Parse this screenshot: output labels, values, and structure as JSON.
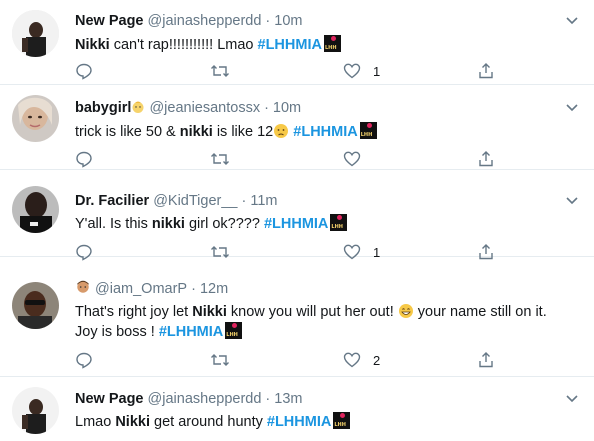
{
  "tweets": [
    {
      "name": "New Page",
      "handle": "@jainashepperdd",
      "time": "10m",
      "text_before": "",
      "bold_word": "Nikki",
      "text_after": " can't rap!!!!!!!!!!! Lmao ",
      "hashtag": "#LHHMIA",
      "like_count": "1",
      "retweet_count": "",
      "reply_count": ""
    },
    {
      "name": "babygirl",
      "handle": "@jeaniesantossx",
      "time": "10m",
      "text_before": "trick is like 50 & ",
      "bold_word": "nikki",
      "text_after": " is like 12",
      "hashtag": "#LHHMIA",
      "like_count": "",
      "retweet_count": "",
      "reply_count": ""
    },
    {
      "name": "Dr. Facilier",
      "handle": "@KidTiger__",
      "time": "11m",
      "text_before": "Y'all. Is this ",
      "bold_word": "nikki",
      "text_after": " girl ok???? ",
      "hashtag": "#LHHMIA",
      "like_count": "1",
      "retweet_count": "",
      "reply_count": ""
    },
    {
      "name": "",
      "handle": "@iam_OmarP",
      "time": "12m",
      "text_before": "That's right joy let ",
      "bold_word": "Nikki",
      "text_after": " know you will put her out! ",
      "text_after2": " your name still on it.",
      "line2": "Joy is boss ! ",
      "hashtag": "#LHHMIA",
      "like_count": "2",
      "retweet_count": "",
      "reply_count": ""
    },
    {
      "name": "New Page",
      "handle": "@jainashepperdd",
      "time": "13m",
      "text_before": "Lmao ",
      "bold_word": "Nikki",
      "text_after": " get around hunty ",
      "hashtag": "#LHHMIA",
      "like_count": "",
      "retweet_count": "",
      "reply_count": ""
    }
  ],
  "badge_text": "LHH",
  "colors": {
    "hashtag": "#1b95e0",
    "secondary": "#657786",
    "border": "#e6ecf0",
    "badge_heart": "#e0245e"
  },
  "icons": [
    "reply-icon",
    "retweet-icon",
    "like-icon",
    "share-icon",
    "caret-down-icon"
  ]
}
